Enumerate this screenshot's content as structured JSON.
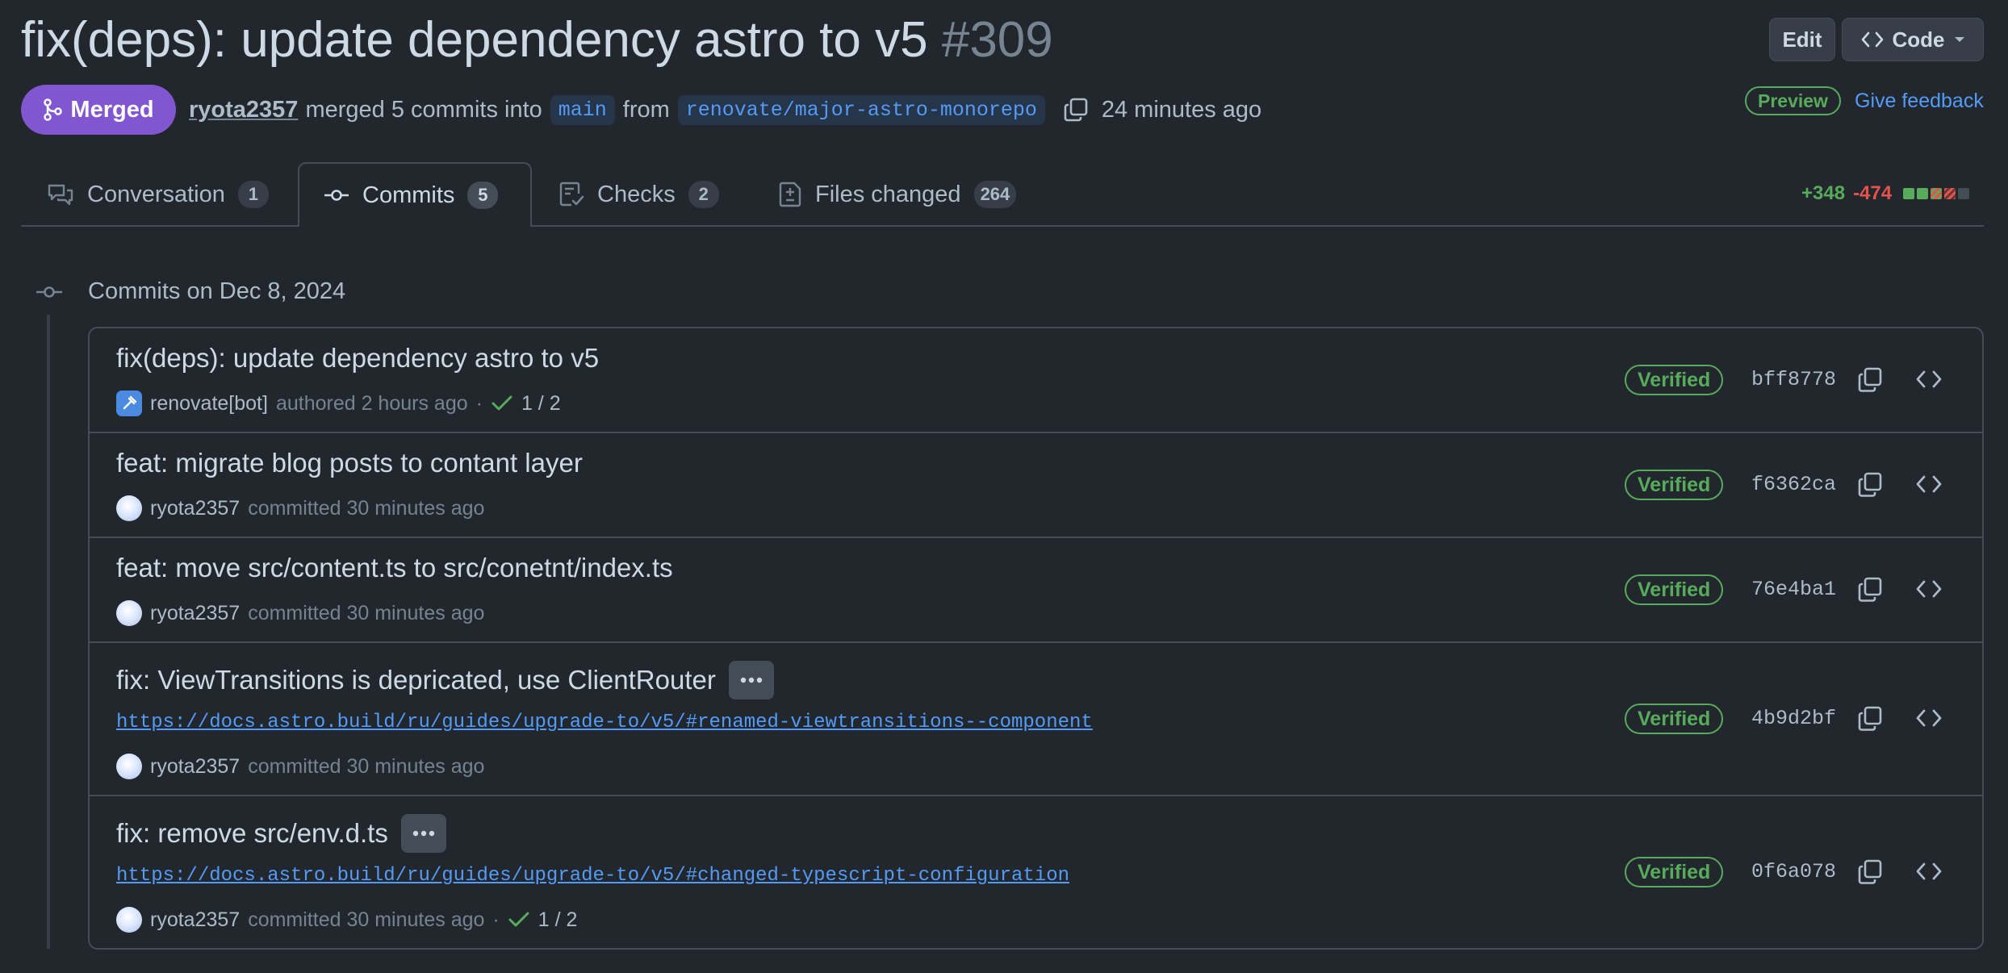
{
  "pr": {
    "title": "fix(deps): update dependency astro to v5",
    "number": "#309",
    "status": "Merged",
    "author": "ryota2357",
    "merged_text": "merged 5 commits into",
    "base_branch": "main",
    "from_text": "from",
    "head_branch": "renovate/major-astro-monorepo",
    "time": "24 minutes ago"
  },
  "header": {
    "edit_label": "Edit",
    "code_label": "Code",
    "preview_label": "Preview",
    "feedback_label": "Give feedback"
  },
  "tabs": [
    {
      "label": "Conversation",
      "count": "1"
    },
    {
      "label": "Commits",
      "count": "5",
      "selected": true
    },
    {
      "label": "Checks",
      "count": "2"
    },
    {
      "label": "Files changed",
      "count": "264"
    }
  ],
  "diffstat": {
    "additions": "+348",
    "deletions": "-474"
  },
  "commits_group": {
    "date_label": "Commits on Dec 8, 2024"
  },
  "commits": [
    {
      "message": "fix(deps): update dependency astro to v5",
      "author": "renovate[bot]",
      "action": "authored 2 hours ago",
      "sep": "·",
      "checks": "1 / 2",
      "verified": "Verified",
      "sha": "bff8778"
    },
    {
      "message": "feat: migrate blog posts to contant layer",
      "author": "ryota2357",
      "action": "committed 30 minutes ago",
      "verified": "Verified",
      "sha": "f6362ca"
    },
    {
      "message": "feat: move src/content.ts to src/conetnt/index.ts",
      "author": "ryota2357",
      "action": "committed 30 minutes ago",
      "verified": "Verified",
      "sha": "76e4ba1"
    },
    {
      "message": "fix: ViewTransitions is depricated, use ClientRouter",
      "link": "https://docs.astro.build/ru/guides/upgrade-to/v5/#renamed-viewtransitions--component",
      "author": "ryota2357",
      "action": "committed 30 minutes ago",
      "verified": "Verified",
      "sha": "4b9d2bf"
    },
    {
      "message": "fix: remove src/env.d.ts",
      "link": "https://docs.astro.build/ru/guides/upgrade-to/v5/#changed-typescript-configuration",
      "author": "ryota2357",
      "action": "committed 30 minutes ago",
      "sep": "·",
      "checks": "1 / 2",
      "verified": "Verified",
      "sha": "0f6a078"
    }
  ]
}
